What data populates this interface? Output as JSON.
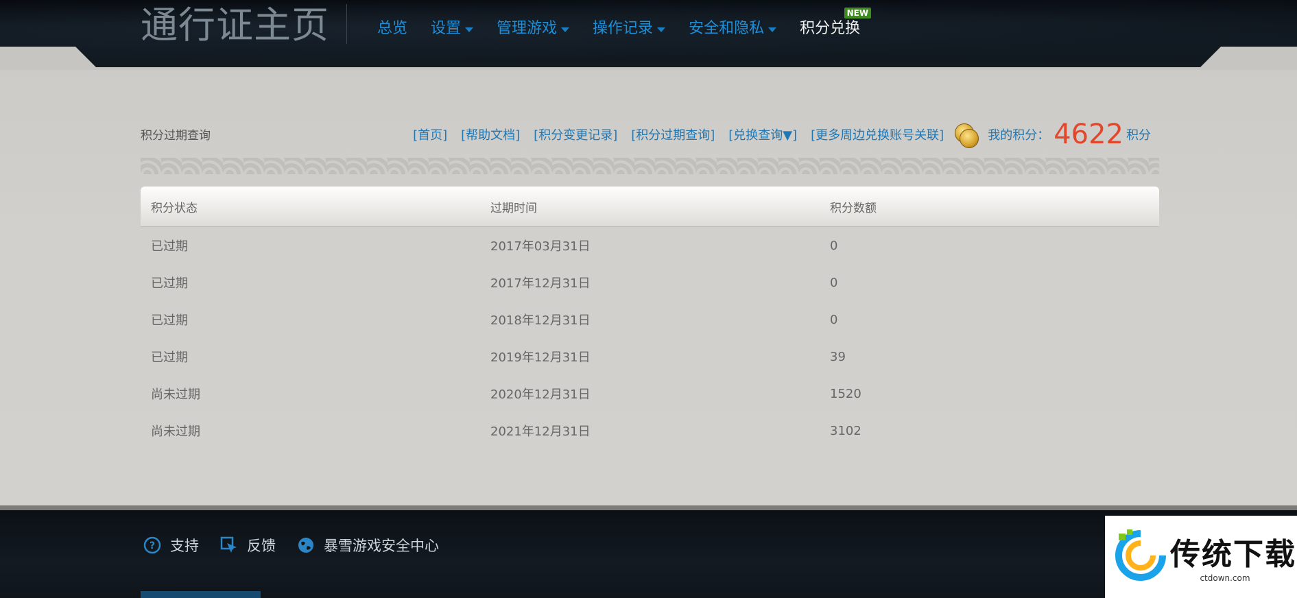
{
  "header": {
    "brand": "通行证主页",
    "nav": [
      {
        "label": "总览",
        "has_dropdown": false
      },
      {
        "label": "设置",
        "has_dropdown": true
      },
      {
        "label": "管理游戏",
        "has_dropdown": true
      },
      {
        "label": "操作记录",
        "has_dropdown": true
      },
      {
        "label": "安全和隐私",
        "has_dropdown": true
      },
      {
        "label": "积分兑换",
        "has_dropdown": false,
        "badge": "NEW",
        "active": true
      }
    ]
  },
  "page": {
    "title": "积分过期查询",
    "links": [
      "[首页]",
      "[帮助文档]",
      "[积分变更记录]",
      "[积分过期查询]",
      "[兑换查询▼]",
      "[更多周边兑换账号关联]"
    ],
    "points_label": "我的积分：",
    "points_value": "4622",
    "points_unit": "积分"
  },
  "table": {
    "headers": [
      "积分状态",
      "过期时间",
      "积分数额"
    ],
    "rows": [
      [
        "已过期",
        "2017年03月31日",
        "0"
      ],
      [
        "已过期",
        "2017年12月31日",
        "0"
      ],
      [
        "已过期",
        "2018年12月31日",
        "0"
      ],
      [
        "已过期",
        "2019年12月31日",
        "39"
      ],
      [
        "尚未过期",
        "2020年12月31日",
        "1520"
      ],
      [
        "尚未过期",
        "2021年12月31日",
        "3102"
      ]
    ]
  },
  "footer": {
    "links": [
      {
        "label": "支持",
        "icon": "question-circle-icon"
      },
      {
        "label": "反馈",
        "icon": "feedback-cursor-icon"
      },
      {
        "label": "暴雪游戏安全中心",
        "icon": "globe-icon"
      }
    ]
  },
  "watermark": {
    "title": "传统下载",
    "url": "ctdown.com"
  },
  "colors": {
    "nav_link": "#1f8ed6",
    "points_value": "#e2472c",
    "badge_new": "#3e8d1e",
    "link": "#1f77b4"
  }
}
